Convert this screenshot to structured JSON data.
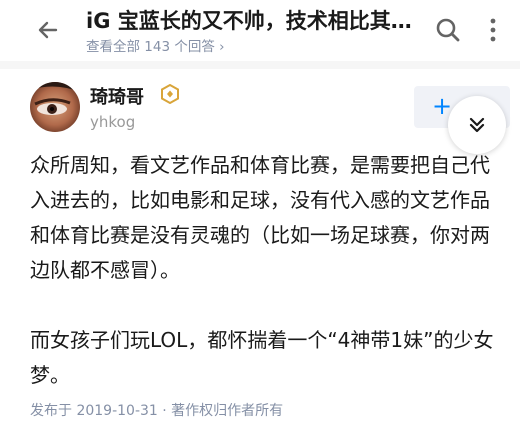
{
  "header": {
    "title": "iG 宝蓝长的又不帅，技术相比其…",
    "subtitle": "查看全部 143 个回答 ›"
  },
  "icons": {
    "back": "arrow-left-icon",
    "search": "search-icon",
    "more": "more-vertical-icon",
    "badge": "hexagon-badge-icon",
    "collapse": "double-chevron-down-icon"
  },
  "author": {
    "name": "琦琦哥",
    "id": "yhkog",
    "follow_label": "+"
  },
  "answer": {
    "paragraphs": [
      "众所周知，看文艺作品和体育比赛，是需要把自己代入进去的，比如电影和足球，没有代入感的文艺作品和体育比赛是没有灵魂的（比如一场足球赛，你对两边队都不感冒）。",
      "而女孩子们玩LOL，都怀揣着一个“4神带1妹”的少女梦。"
    ],
    "meta": "发布于 2019-10-31 · 著作权归作者所有"
  },
  "colors": {
    "accent": "#0084ff",
    "badge": "#d9a53a",
    "muted": "#8590a6"
  }
}
